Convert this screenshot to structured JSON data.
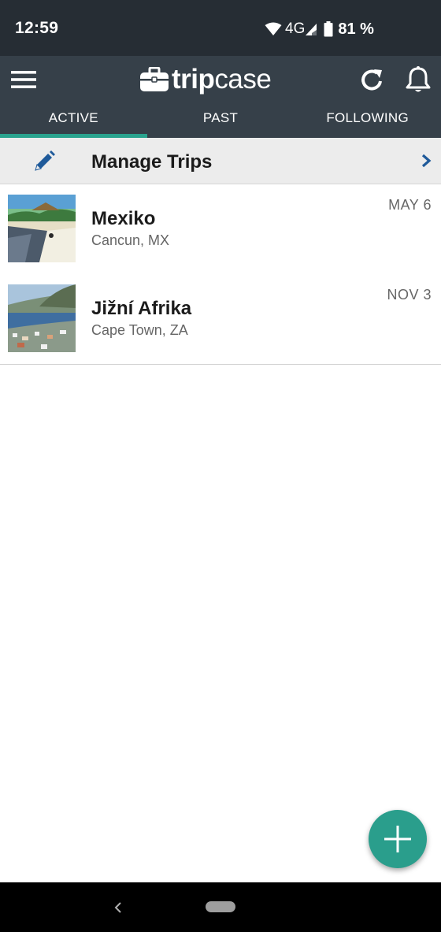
{
  "status_bar": {
    "time": "12:59",
    "network": "4G",
    "battery": "81 %"
  },
  "header": {
    "logo_prefix": "trip",
    "logo_suffix": "case",
    "icons": [
      "menu-icon",
      "refresh-icon",
      "bell-icon"
    ]
  },
  "tabs": [
    {
      "label": "ACTIVE",
      "active": true
    },
    {
      "label": "PAST",
      "active": false
    },
    {
      "label": "FOLLOWING",
      "active": false
    }
  ],
  "manage": {
    "label": "Manage Trips"
  },
  "trips": [
    {
      "name": "Mexiko",
      "location": "Cancun, MX",
      "date": "MAY 6"
    },
    {
      "name": "Jižní Afrika",
      "location": "Cape Town, ZA",
      "date": "NOV 3"
    }
  ],
  "colors": {
    "status_bar": "#262d34",
    "app_bar": "#364049",
    "accent": "#2aa38e",
    "fab": "#2a9e8c",
    "link_blue": "#1f5a9a"
  }
}
